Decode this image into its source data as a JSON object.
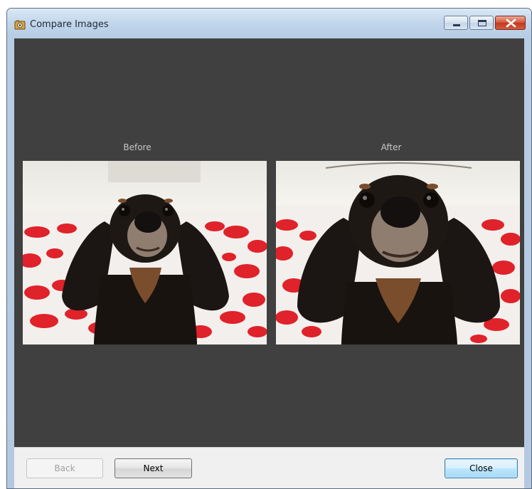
{
  "window": {
    "title": "Compare Images",
    "icon": "app-photo-icon",
    "controls": {
      "minimize_icon": "minimize-icon",
      "maximize_icon": "maximize-icon",
      "close_icon": "close-icon"
    }
  },
  "comparison": {
    "before_label": "Before",
    "after_label": "After",
    "before_image": "dog-photo-original",
    "after_image": "dog-photo-corrected"
  },
  "footer": {
    "back_label": "Back",
    "next_label": "Next",
    "close_label": "Close"
  },
  "colors": {
    "content_background": "#404040",
    "footer_background": "#f0f0f0",
    "close_button_accent": "#c23a1f"
  }
}
